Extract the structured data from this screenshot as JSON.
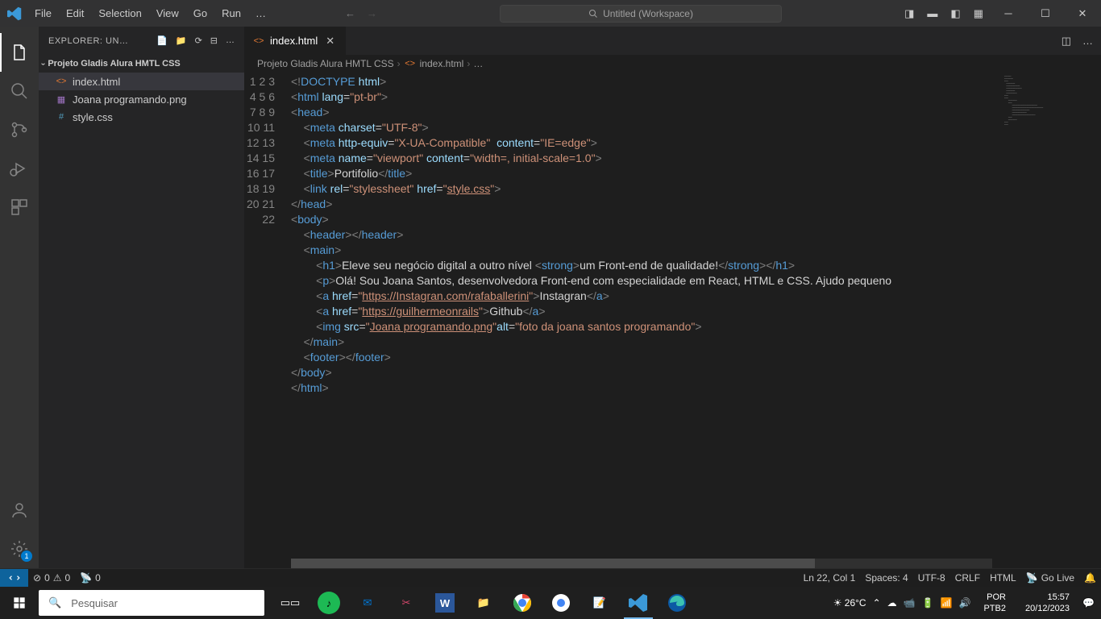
{
  "titlebar": {
    "menu": [
      "File",
      "Edit",
      "Selection",
      "View",
      "Go",
      "Run",
      "…"
    ],
    "search_text": "Untitled (Workspace)"
  },
  "sidebar": {
    "header": "EXPLORER: UNTI…",
    "folder": "Projeto Gladis Alura HMTL CSS",
    "files": [
      {
        "icon": "<>",
        "name": "index.html",
        "color": "#e37933",
        "selected": true
      },
      {
        "icon": "🖼",
        "name": "Joana programando.png",
        "color": "#a074c4",
        "selected": false
      },
      {
        "icon": "#",
        "name": "style.css",
        "color": "#519aba",
        "selected": false
      }
    ]
  },
  "tabs": [
    {
      "icon": "<>",
      "label": "index.html"
    }
  ],
  "breadcrumb": {
    "folder": "Projeto Gladis Alura HMTL CSS",
    "file": "index.html",
    "tail": "…"
  },
  "code": {
    "lines": 22
  },
  "statusbar": {
    "errors": "0",
    "warnings": "0",
    "port": "0",
    "ln": "Ln 22, Col 1",
    "spaces": "Spaces: 4",
    "encoding": "UTF-8",
    "eol": "CRLF",
    "lang": "HTML",
    "golive": "Go Live"
  },
  "taskbar": {
    "search_placeholder": "Pesquisar",
    "weather": "26°C",
    "lang1": "POR",
    "lang2": "PTB2",
    "time": "15:57",
    "date": "20/12/2023"
  },
  "activity_badges": {
    "settings": "1"
  }
}
